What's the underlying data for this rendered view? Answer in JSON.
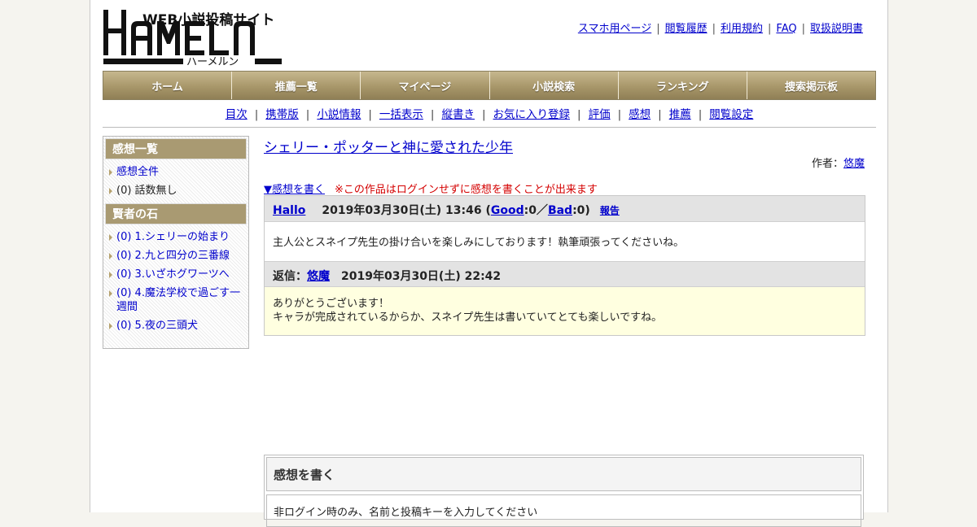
{
  "site": {
    "logo_text": "HAMELN",
    "logo_subtitle": "WEB小説投稿サイト",
    "logo_kana": "ハーメルン"
  },
  "top_links": [
    "スマホ用ページ",
    "閲覧履歴",
    "利用規約",
    "FAQ",
    "取扱説明書"
  ],
  "global_nav": [
    "ホーム",
    "推薦一覧",
    "マイページ",
    "小説検索",
    "ランキング",
    "捜索掲示板"
  ],
  "sub_nav": [
    "目次",
    "携帯版",
    "小説情報",
    "一括表示",
    "縦書き",
    "お気に入り登録",
    "評価",
    "感想",
    "推薦",
    "閲覧設定"
  ],
  "sidebar": {
    "section1_title": "感想一覧",
    "all_reviews": "感想全件",
    "no_episode": "(0) 話数無し",
    "section2_title": "賢者の石",
    "chapters": [
      "(0) 1.シェリーの始まり",
      "(0) 2.九と四分の三番線",
      "(0) 3.いざホグワーツへ",
      "(0) 4.魔法学校で過ごす一週間",
      "(0) 5.夜の三頭犬"
    ]
  },
  "novel": {
    "title": "シェリー・ポッターと神に愛された少年",
    "author_label": "作者：",
    "author": "悠魔"
  },
  "write_link": "▼感想を書く",
  "guest_note": "※この作品はログインせずに感想を書くことが出来ます",
  "review": {
    "user": "Hallo",
    "date": "2019年03月30日(土) 13:46",
    "good_label": "Good",
    "good_count": ":0／",
    "bad_label": "Bad",
    "bad_count": ":0)",
    "open_paren": "(",
    "report": "報告",
    "body": "主人公とスネイプ先生の掛け合いを楽しみにしております！執筆頑張ってくださいね。"
  },
  "reply": {
    "label": "返信：",
    "author": "悠魔",
    "date": "2019年03月30日(土) 22:42",
    "line1": "ありがとうございます！",
    "line2": "キャラが完成されているからか、スネイプ先生は書いていてとても楽しいですね。"
  },
  "write_form": {
    "title": "感想を書く",
    "note": "非ログイン時のみ、名前と投稿キーを入力してください"
  },
  "colors": {
    "nav_gold": "#a8976a",
    "reply_bg": "#ffffe0",
    "warning_red": "#d40000",
    "link_blue": "#0000cc"
  }
}
